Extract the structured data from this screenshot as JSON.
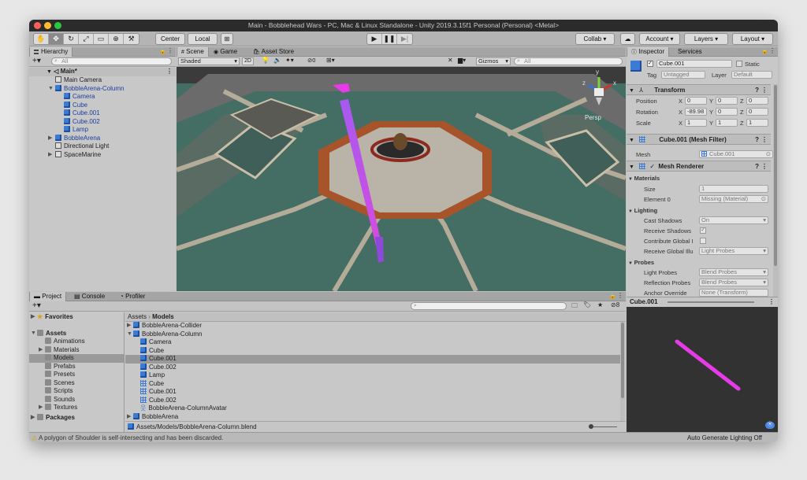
{
  "window": {
    "title": "Main - Bobblehead Wars - PC, Mac & Linux Standalone - Unity 2019.3.15f1 Personal (Personal) <Metal>"
  },
  "toolbar": {
    "pivot": "Center",
    "space": "Local",
    "collab": "Collab ▾",
    "account": "Account ▾",
    "layers": "Layers ▾",
    "layout": "Layout ▾"
  },
  "hierarchy": {
    "tab": "Hierarchy",
    "search_placeholder": "All",
    "scene": "Main*",
    "items": [
      {
        "label": "Main Camera",
        "depth": 1,
        "blue": false,
        "arrow": ""
      },
      {
        "label": "BobbleArena-Column",
        "depth": 1,
        "blue": true,
        "arrow": "▼"
      },
      {
        "label": "Camera",
        "depth": 2,
        "blue": true,
        "arrow": ""
      },
      {
        "label": "Cube",
        "depth": 2,
        "blue": true,
        "arrow": ""
      },
      {
        "label": "Cube.001",
        "depth": 2,
        "blue": true,
        "arrow": ""
      },
      {
        "label": "Cube.002",
        "depth": 2,
        "blue": true,
        "arrow": ""
      },
      {
        "label": "Lamp",
        "depth": 2,
        "blue": true,
        "arrow": ""
      },
      {
        "label": "BobbleArena",
        "depth": 1,
        "blue": true,
        "arrow": "▶"
      },
      {
        "label": "Directional Light",
        "depth": 1,
        "blue": false,
        "arrow": ""
      },
      {
        "label": "SpaceMarine",
        "depth": 1,
        "blue": false,
        "arrow": "▶"
      }
    ]
  },
  "scene": {
    "tabs": [
      "Scene",
      "Game",
      "Asset Store"
    ],
    "shading": "Shaded",
    "mode_2d": "2D",
    "hidden_count": "0",
    "gizmos": "Gizmos",
    "search_placeholder": "All",
    "persp": "Persp",
    "axis_y": "y",
    "axis_x": "x",
    "axis_z": "z"
  },
  "inspector": {
    "tabs": [
      "Inspector",
      "Services"
    ],
    "object_name": "Cube.001",
    "static": "Static",
    "tag_label": "Tag",
    "tag": "Untagged",
    "layer_label": "Layer",
    "layer": "Default",
    "transform": {
      "title": "Transform",
      "position_label": "Position",
      "rotation_label": "Rotation",
      "scale_label": "Scale",
      "position": [
        "0",
        "0",
        "0"
      ],
      "rotation": [
        "-89.98",
        "0",
        "0"
      ],
      "scale": [
        "1",
        "1",
        "1"
      ]
    },
    "mesh_filter": {
      "title": "Cube.001 (Mesh Filter)",
      "mesh_label": "Mesh",
      "mesh": "Cube.001"
    },
    "mesh_renderer": {
      "title": "Mesh Renderer",
      "materials": "Materials",
      "size_label": "Size",
      "size": "1",
      "element_label": "Element 0",
      "element": "Missing (Material)",
      "lighting": "Lighting",
      "cast_label": "Cast Shadows",
      "cast": "On",
      "receive_label": "Receive Shadows",
      "contribute_label": "Contribute Global I",
      "receive_gi_label": "Receive Global Illu",
      "receive_gi": "Light Probes",
      "probes": "Probes",
      "light_probes_label": "Light Probes",
      "light_probes": "Blend Probes",
      "reflection_label": "Reflection Probes",
      "reflection": "Blend Probes",
      "anchor_label": "Anchor Override",
      "anchor": "None (Transform)"
    },
    "preview_title": "Cube.001"
  },
  "project": {
    "tabs": [
      "Project",
      "Console",
      "Profiler"
    ],
    "hidden_count": "8",
    "tree": [
      {
        "label": "Favorites",
        "depth": 0,
        "bold": true,
        "arrow": "▶",
        "icon": "star"
      },
      {
        "label": "Assets",
        "depth": 0,
        "bold": true,
        "arrow": "▼",
        "icon": "folder"
      },
      {
        "label": "Animations",
        "depth": 1,
        "bold": false,
        "arrow": "",
        "icon": "folder"
      },
      {
        "label": "Materials",
        "depth": 1,
        "bold": false,
        "arrow": "▶",
        "icon": "folder"
      },
      {
        "label": "Models",
        "depth": 1,
        "bold": false,
        "arrow": "",
        "icon": "folder",
        "selected": true
      },
      {
        "label": "Prefabs",
        "depth": 1,
        "bold": false,
        "arrow": "",
        "icon": "folder"
      },
      {
        "label": "Presets",
        "depth": 1,
        "bold": false,
        "arrow": "",
        "icon": "folder"
      },
      {
        "label": "Scenes",
        "depth": 1,
        "bold": false,
        "arrow": "",
        "icon": "folder"
      },
      {
        "label": "Scripts",
        "depth": 1,
        "bold": false,
        "arrow": "",
        "icon": "folder"
      },
      {
        "label": "Sounds",
        "depth": 1,
        "bold": false,
        "arrow": "",
        "icon": "folder"
      },
      {
        "label": "Textures",
        "depth": 1,
        "bold": false,
        "arrow": "▶",
        "icon": "folder"
      },
      {
        "label": "Packages",
        "depth": 0,
        "bold": true,
        "arrow": "▶",
        "icon": "folder"
      }
    ],
    "breadcrumb": [
      "Assets",
      "Models"
    ],
    "files": [
      {
        "label": "BobbleArena-Collider",
        "depth": 0,
        "arrow": "▶",
        "icon": "cube"
      },
      {
        "label": "BobbleArena-Column",
        "depth": 0,
        "arrow": "▼",
        "icon": "cube"
      },
      {
        "label": "Camera",
        "depth": 1,
        "arrow": "",
        "icon": "cube"
      },
      {
        "label": "Cube",
        "depth": 1,
        "arrow": "",
        "icon": "cube"
      },
      {
        "label": "Cube.001",
        "depth": 1,
        "arrow": "",
        "icon": "cube",
        "selected": true
      },
      {
        "label": "Cube.002",
        "depth": 1,
        "arrow": "",
        "icon": "cube"
      },
      {
        "label": "Lamp",
        "depth": 1,
        "arrow": "",
        "icon": "cube"
      },
      {
        "label": "Cube",
        "depth": 1,
        "arrow": "",
        "icon": "mesh"
      },
      {
        "label": "Cube.001",
        "depth": 1,
        "arrow": "",
        "icon": "mesh"
      },
      {
        "label": "Cube.002",
        "depth": 1,
        "arrow": "",
        "icon": "mesh"
      },
      {
        "label": "BobbleArena-ColumnAvatar",
        "depth": 1,
        "arrow": "",
        "icon": "avatar"
      },
      {
        "label": "BobbleArena",
        "depth": 0,
        "arrow": "▶",
        "icon": "cube"
      }
    ],
    "path": "Assets/Models/BobbleArena-Column.blend"
  },
  "status": {
    "message": "A polygon of Shoulder is self-intersecting and has been discarded.",
    "right": "Auto Generate Lighting Off"
  },
  "colors": {
    "accent_magenta": "#e83be8",
    "selection": "#8f8f8f",
    "unity_blue": "#3a7bd5"
  }
}
